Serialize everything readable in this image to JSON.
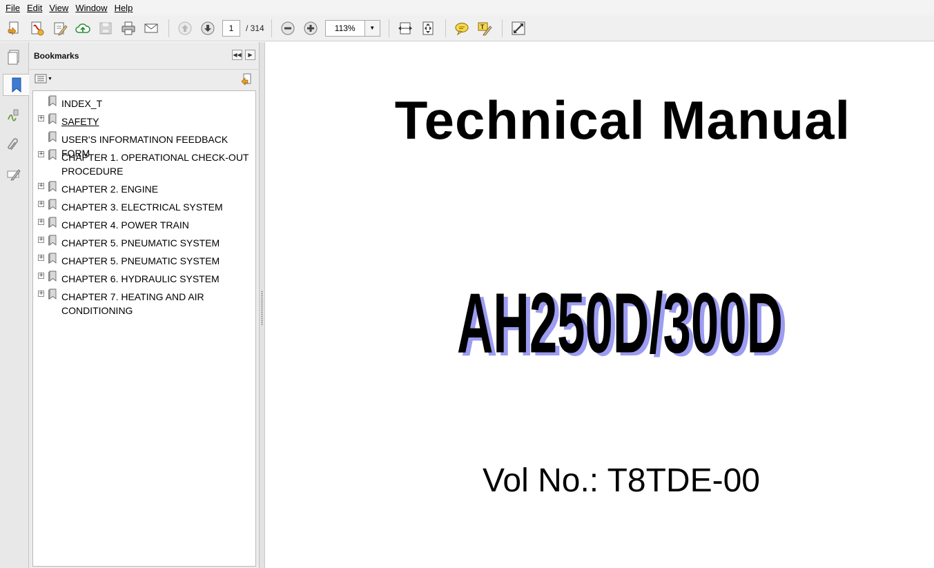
{
  "menu": [
    "File",
    "Edit",
    "View",
    "Window",
    "Help"
  ],
  "toolbar": {
    "page_current": "1",
    "page_total": "/  314",
    "zoom": "113%"
  },
  "bookmarks": {
    "title": "Bookmarks",
    "items": [
      {
        "label": "INDEX_T",
        "expandable": false,
        "link": false
      },
      {
        "label": "SAFETY",
        "expandable": true,
        "link": true
      },
      {
        "label": "USER'S INFORMATINON FEEDBACK FORM",
        "expandable": false,
        "link": false
      },
      {
        "label": "CHAPTER 1. OPERATIONAL CHECK-OUT PROCEDURE",
        "expandable": true,
        "link": false
      },
      {
        "label": "CHAPTER 2. ENGINE",
        "expandable": true,
        "link": false
      },
      {
        "label": "CHAPTER 3. ELECTRICAL SYSTEM",
        "expandable": true,
        "link": false
      },
      {
        "label": "CHAPTER 4. POWER TRAIN",
        "expandable": true,
        "link": false
      },
      {
        "label": "CHAPTER 5. PNEUMATIC SYSTEM",
        "expandable": true,
        "link": false
      },
      {
        "label": "CHAPTER 5. PNEUMATIC SYSTEM",
        "expandable": true,
        "link": false
      },
      {
        "label": "CHAPTER 6. HYDRAULIC SYSTEM",
        "expandable": true,
        "link": false
      },
      {
        "label": "CHAPTER 7. HEATING AND AIR CONDITIONING",
        "expandable": true,
        "link": false
      }
    ]
  },
  "document": {
    "title": "Technical Manual",
    "model": "AH250D/300D",
    "volume": "Vol No.: T8TDE-00"
  },
  "colors": {
    "model_shadow": "#9c9cf2",
    "toolbar_bg": "#f0f0f0",
    "panel_bg": "#ececec"
  }
}
